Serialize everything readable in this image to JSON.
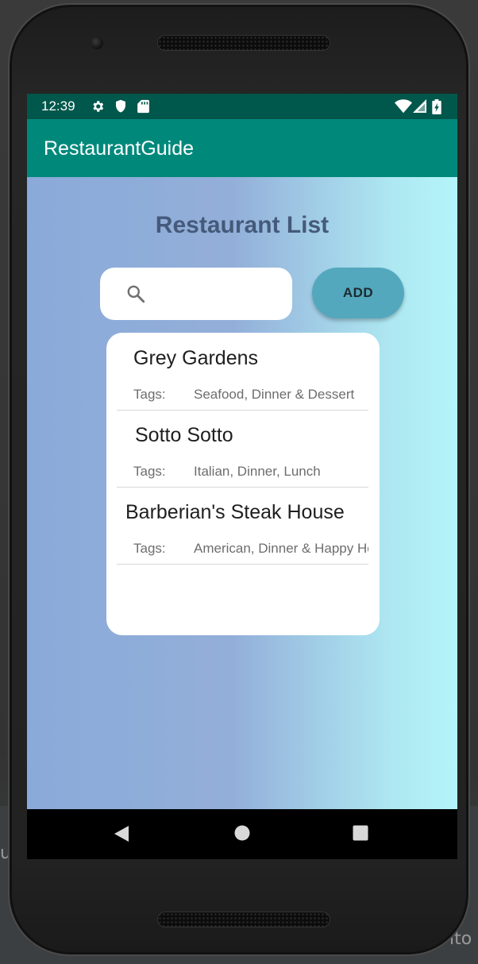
{
  "status_bar": {
    "time": "12:39",
    "icons": [
      "settings-gear-icon",
      "shield-icon",
      "sd-card-icon",
      "wifi-icon",
      "signal-icon",
      "battery-charging-icon"
    ]
  },
  "app_bar": {
    "title": "RestaurantGuide"
  },
  "main": {
    "heading": "Restaurant List",
    "search": {
      "placeholder": "",
      "value": ""
    },
    "add_label": "ADD",
    "restaurants": [
      {
        "name": "Grey Gardens",
        "tags_label": "Tags:",
        "tags": "Seafood, Dinner & Dessert"
      },
      {
        "name": "Sotto Sotto",
        "tags_label": "Tags:",
        "tags": "Italian, Dinner, Lunch"
      },
      {
        "name": "Barberian's Steak House",
        "tags_label": "Tags:",
        "tags": "American, Dinner & Happy Hour"
      }
    ]
  },
  "nav_bar": {
    "buttons": [
      "back-icon",
      "home-icon",
      "recents-icon"
    ]
  },
  "colors": {
    "status_bar": "#00574B",
    "app_bar": "#00897B",
    "add_button": "#53a8bd",
    "heading": "#455a7a",
    "gradient_left": "#8aaad9",
    "gradient_right": "#b4f4fa"
  }
}
